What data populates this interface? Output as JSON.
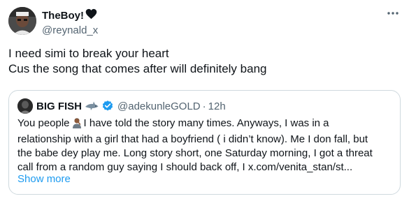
{
  "tweet": {
    "author_name": "TheBoy!",
    "author_handle": "@reynald_x",
    "text_lines": [
      "I need simi to break your heart",
      "Cus the song that comes after will definitely bang"
    ]
  },
  "quote": {
    "author_name": "BIG FISH",
    "author_handle": "@adekunleGOLD",
    "separator": "·",
    "time": "12h",
    "line1_before_emoji": "You people",
    "line1_after_emoji": "I have told the story many times. Anyways, I was in a",
    "lines": [
      "relationship with a girl that had a boyfriend ( i didn’t know). Me I don fall, but",
      "the babe dey play me. Long story short, one Saturday morning, I got a threat",
      "call from a random guy saying I should back off, I x.com/venita_stan/st..."
    ],
    "show_more": "Show more"
  },
  "icons": {
    "heart": "black-heart-icon",
    "more": "more-options-icon",
    "shark": "shark-icon",
    "verified": "verified-badge-icon",
    "person": "facepalm-emoji-icon"
  },
  "colors": {
    "text_primary": "#0f1419",
    "text_secondary": "#536471",
    "link": "#1d9bf0",
    "border": "#cfd9de"
  }
}
